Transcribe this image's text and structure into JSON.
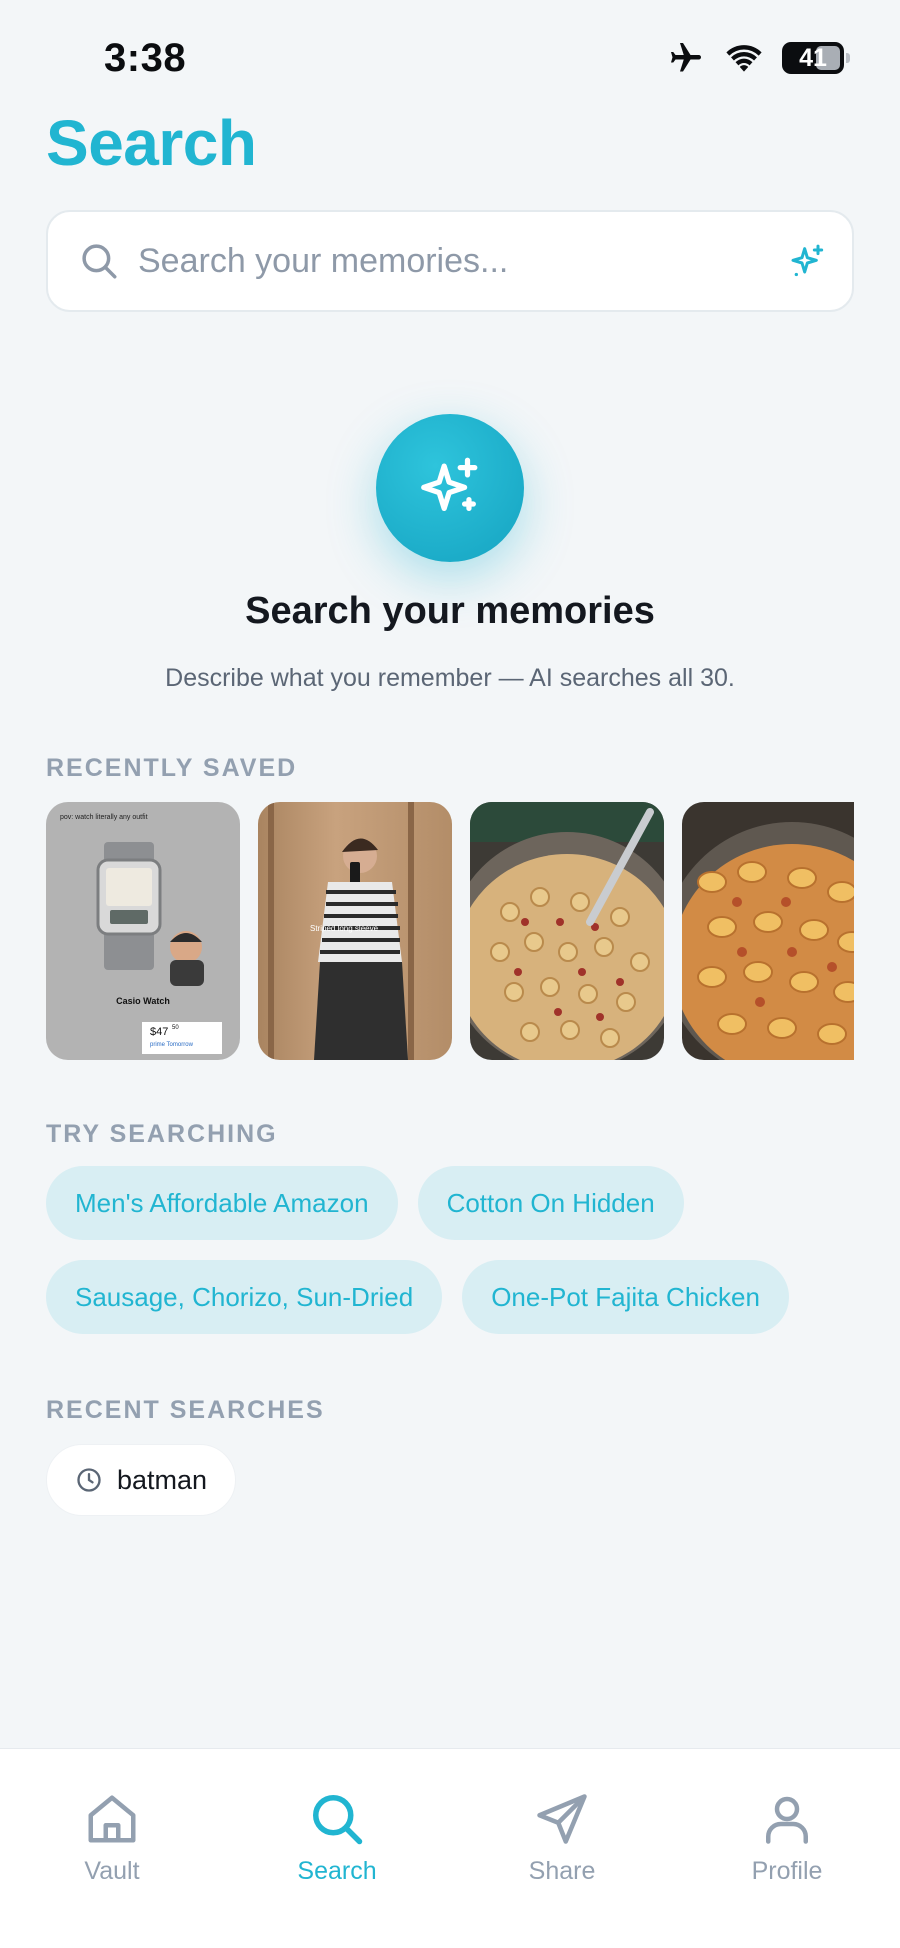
{
  "status_bar": {
    "time": "3:38",
    "battery": "41"
  },
  "header": {
    "title": "Search"
  },
  "search": {
    "placeholder": "Search your memories..."
  },
  "hero": {
    "title": "Search your memories",
    "subtitle": "Describe what you remember — AI searches all 30."
  },
  "recently_saved": {
    "label": "RECENTLY SAVED",
    "items": [
      {
        "caption_top": "pov: watch literally any outfit",
        "title": "Casio Watch",
        "price": "$47",
        "price_cents": "50",
        "delivery": "prime Tomorrow"
      },
      {
        "shirt_text": "Striped long sleeve"
      },
      {
        "description": "pasta dish"
      },
      {
        "description": "pasta dish"
      }
    ]
  },
  "try_searching": {
    "label": "TRY SEARCHING",
    "chips": [
      "Men's Affordable Amazon",
      "Cotton On Hidden",
      "Sausage, Chorizo, Sun-Dried",
      "One-Pot Fajita Chicken"
    ]
  },
  "recent_searches": {
    "label": "RECENT SEARCHES",
    "items": [
      "batman"
    ]
  },
  "tabs": [
    {
      "label": "Vault",
      "icon": "home-icon",
      "active": false
    },
    {
      "label": "Search",
      "icon": "search-icon",
      "active": true
    },
    {
      "label": "Share",
      "icon": "send-icon",
      "active": false
    },
    {
      "label": "Profile",
      "icon": "user-icon",
      "active": false
    }
  ],
  "colors": {
    "accent": "#21b5d1",
    "background": "#f3f6f8",
    "chip_bg": "#d8eef3",
    "muted": "#93a0b0",
    "text": "#14181f"
  }
}
